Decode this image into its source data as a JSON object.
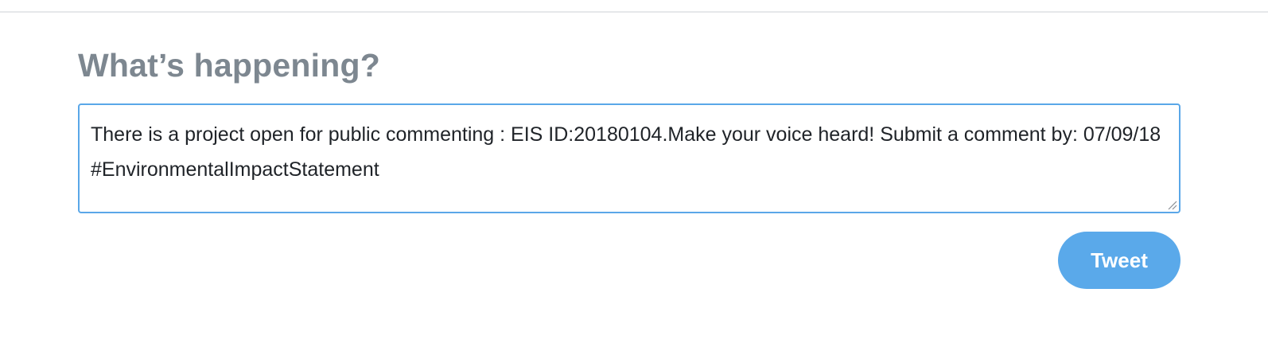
{
  "composer": {
    "heading": "What’s happening?",
    "tweet_text": "There is a project open for public commenting : EIS ID:20180104.Make your voice heard! Submit a comment by: 07/09/18 #EnvironmentalImpactStatement",
    "tweet_button_label": "Tweet"
  },
  "colors": {
    "heading": "#7d8790",
    "textarea_border_focus": "#5aa7e8",
    "tweet_button_bg": "#5aa9ea",
    "tweet_button_text": "#ffffff"
  },
  "icons": {
    "resize_handle": "resize-handle-icon"
  }
}
